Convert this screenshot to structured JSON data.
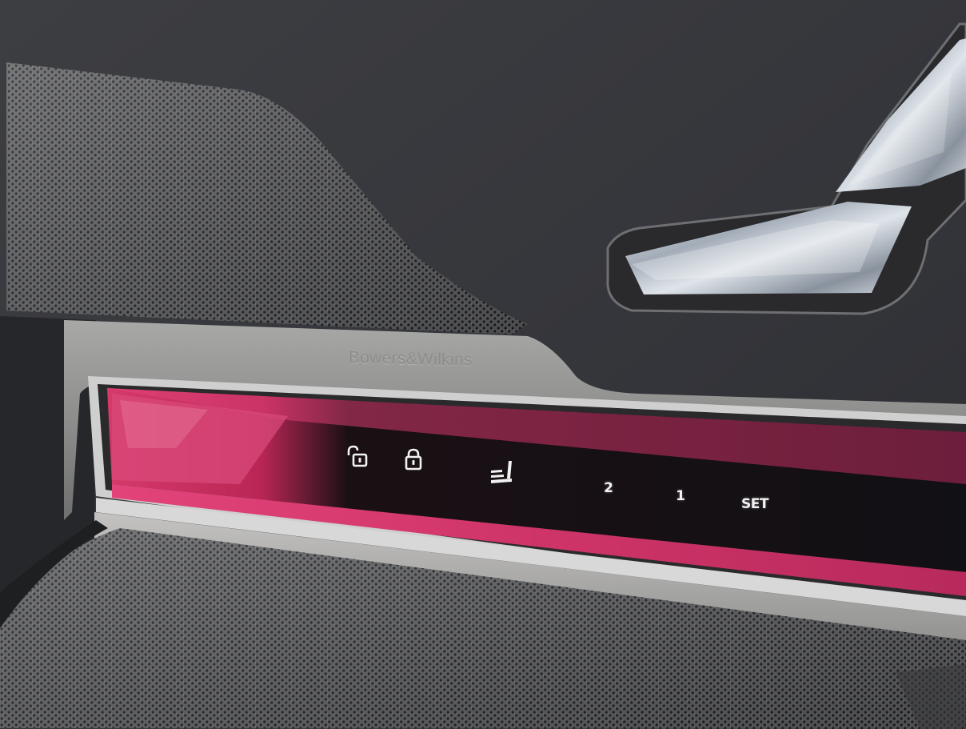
{
  "brand": {
    "label": "Bowers&Wilkins"
  },
  "controls": {
    "unlock_icon": "unlock-icon",
    "lock_icon": "lock-icon",
    "seat_icon": "seat-adjust-icon",
    "memory_2": "2",
    "memory_1": "1",
    "set": "SET"
  },
  "colors": {
    "panel_leather": "#3a3b3e",
    "accent_ambient": "#c8285a",
    "trim_chrome": "#c9c9c9",
    "crystal": "#cfd6de"
  }
}
